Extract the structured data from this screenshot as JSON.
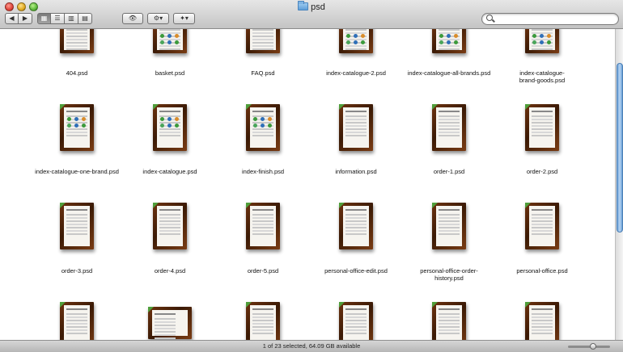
{
  "window": {
    "title": "psd"
  },
  "toolbar": {
    "back_glyph": "◀",
    "forward_glyph": "▶",
    "view_icons_glyph": "▦",
    "view_list_glyph": "☰",
    "view_columns_glyph": "▥",
    "view_coverflow_glyph": "▤",
    "quicklook_glyph": "👁",
    "action_glyph": "⚙▾",
    "dropbox_glyph": "✦▾",
    "active_view": "icons"
  },
  "search": {
    "value": "",
    "placeholder": ""
  },
  "files": {
    "row1": [
      "404.psd",
      "basket.psd",
      "FAQ.psd",
      "index-catalogue-2.psd",
      "index-catalogue-all-brands.psd",
      "index-catalogue-brand-goods.psd"
    ],
    "row2": [
      "index-catalogue-one-brand.psd",
      "index-catalogue.psd",
      "index-finish.psd",
      "information.psd",
      "order-1.psd",
      "order-2.psd"
    ],
    "row3": [
      "order-3.psd",
      "order-4.psd",
      "order-5.psd",
      "personal-office-edit.psd",
      "personal-office-order-history.psd",
      "personal-office.psd"
    ]
  },
  "status": {
    "text": "1 of 23 selected, 64.09 GB available"
  },
  "colors": {
    "thumb_frame": "#5a2a0c",
    "scroll_thumb": "#6aa0d8"
  }
}
